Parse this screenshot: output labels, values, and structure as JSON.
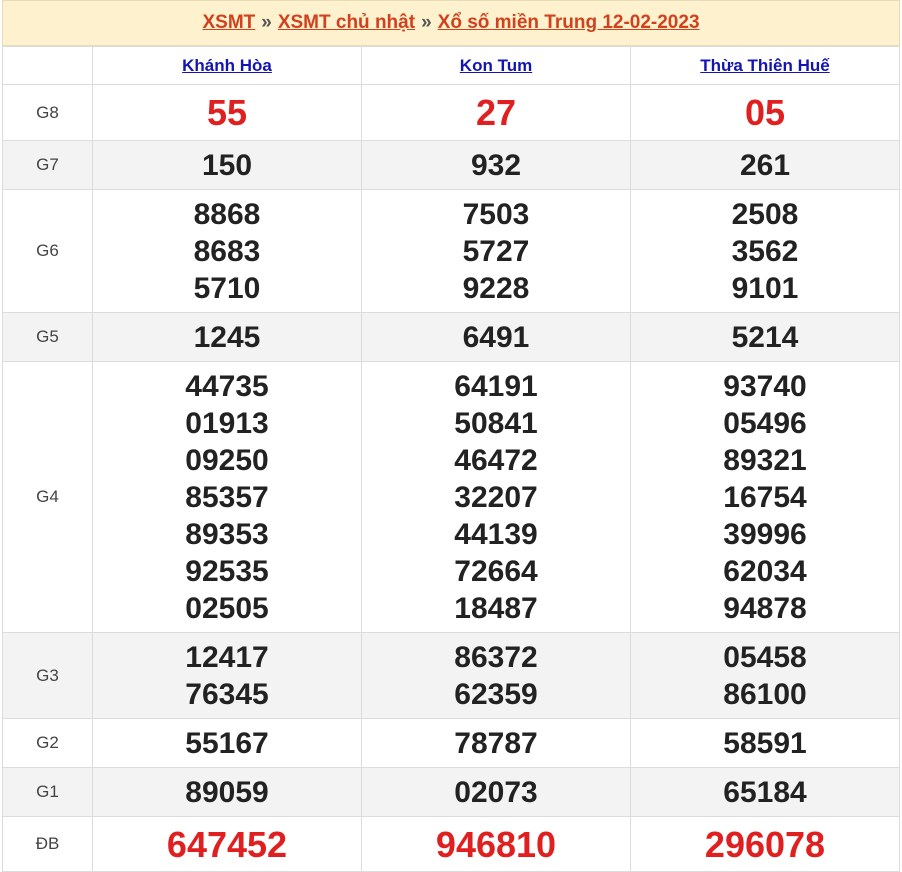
{
  "breadcrumb": {
    "items": [
      "XSMT",
      "XSMT chủ nhật",
      "Xổ số miền Trung 12-02-2023"
    ],
    "separator": "»"
  },
  "provinces": [
    "Khánh Hòa",
    "Kon Tum",
    "Thừa Thiên Huế"
  ],
  "prizes": [
    {
      "label": "G8",
      "results": [
        [
          "55"
        ],
        [
          "27"
        ],
        [
          "05"
        ]
      ]
    },
    {
      "label": "G7",
      "results": [
        [
          "150"
        ],
        [
          "932"
        ],
        [
          "261"
        ]
      ]
    },
    {
      "label": "G6",
      "results": [
        [
          "8868",
          "8683",
          "5710"
        ],
        [
          "7503",
          "5727",
          "9228"
        ],
        [
          "2508",
          "3562",
          "9101"
        ]
      ]
    },
    {
      "label": "G5",
      "results": [
        [
          "1245"
        ],
        [
          "6491"
        ],
        [
          "5214"
        ]
      ]
    },
    {
      "label": "G4",
      "results": [
        [
          "44735",
          "01913",
          "09250",
          "85357",
          "89353",
          "92535",
          "02505"
        ],
        [
          "64191",
          "50841",
          "46472",
          "32207",
          "44139",
          "72664",
          "18487"
        ],
        [
          "93740",
          "05496",
          "89321",
          "16754",
          "39996",
          "62034",
          "94878"
        ]
      ]
    },
    {
      "label": "G3",
      "results": [
        [
          "12417",
          "76345"
        ],
        [
          "86372",
          "62359"
        ],
        [
          "05458",
          "86100"
        ]
      ]
    },
    {
      "label": "G2",
      "results": [
        [
          "55167"
        ],
        [
          "78787"
        ],
        [
          "58591"
        ]
      ]
    },
    {
      "label": "G1",
      "results": [
        [
          "89059"
        ],
        [
          "02073"
        ],
        [
          "65184"
        ]
      ]
    },
    {
      "label": "ĐB",
      "results": [
        [
          "647452"
        ],
        [
          "946810"
        ],
        [
          "296078"
        ]
      ]
    }
  ],
  "colors": {
    "accent_red": "#e02020",
    "link_blue": "#1414b4",
    "title_bg": "#fdf2cd"
  }
}
